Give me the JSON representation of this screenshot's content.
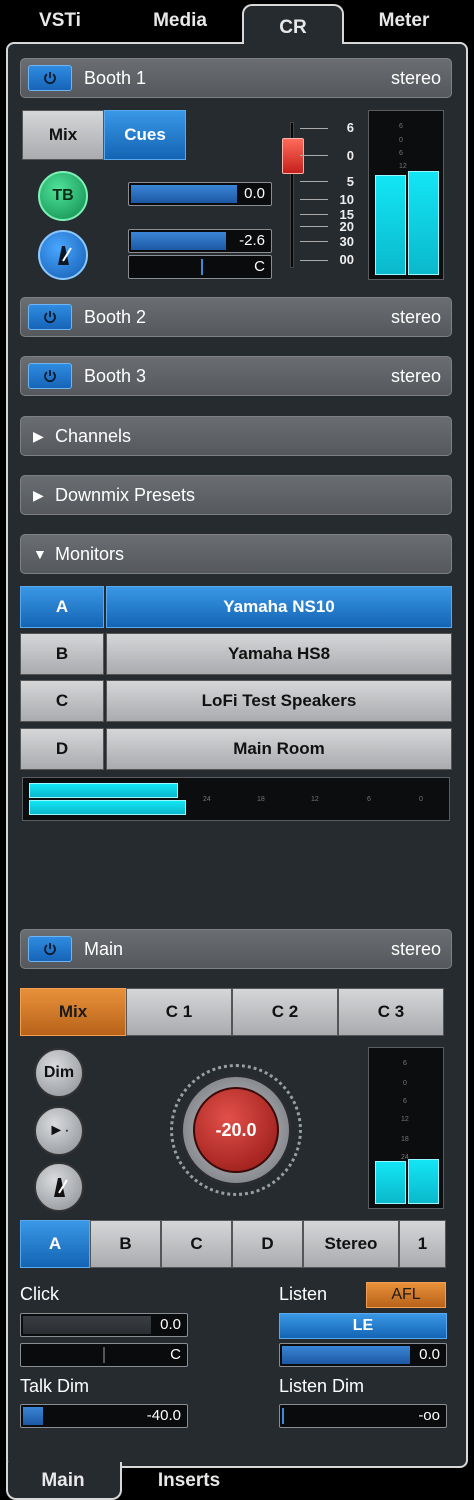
{
  "top_tabs": [
    "VSTi",
    "Media",
    "CR",
    "Meter"
  ],
  "booth1": {
    "name": "Booth 1",
    "format": "stereo",
    "mix_label": "Mix",
    "cues_label": "Cues",
    "tb_label": "TB",
    "level1": "0.0",
    "level2": "-2.6",
    "pan": "C",
    "fader_scale": [
      "6",
      "0",
      "5",
      "10",
      "15",
      "20",
      "30",
      "00"
    ],
    "meter_scale": [
      "6",
      "0",
      "6",
      "12"
    ],
    "meter_levels": [
      0.62,
      0.64
    ]
  },
  "booth2": {
    "name": "Booth 2",
    "format": "stereo"
  },
  "booth3": {
    "name": "Booth 3",
    "format": "stereo"
  },
  "channels": {
    "name": "Channels"
  },
  "downmix": {
    "name": "Downmix Presets"
  },
  "monitors": {
    "name": "Monitors",
    "items": [
      {
        "key": "A",
        "name": "Yamaha NS10"
      },
      {
        "key": "B",
        "name": "Yamaha HS8"
      },
      {
        "key": "C",
        "name": "LoFi Test Speakers"
      },
      {
        "key": "D",
        "name": "Main Room"
      }
    ],
    "meter_scale": [
      "24",
      "18",
      "12",
      "6",
      "0"
    ],
    "meter_levels": [
      0.36,
      0.38
    ]
  },
  "main": {
    "name": "Main",
    "format": "stereo",
    "source_tabs": [
      "Mix",
      "C 1",
      "C 2",
      "C 3"
    ],
    "dim_label": "Dim",
    "knob_value": "-20.0",
    "meter_scale": [
      "6",
      "0",
      "6",
      "12",
      "18",
      "24"
    ],
    "meter_levels": [
      0.28,
      0.29
    ],
    "speaker_buttons": [
      "A",
      "B",
      "C",
      "D",
      "Stereo",
      "1"
    ],
    "click_label": "Click",
    "click_level": "0.0",
    "click_pan": "C",
    "listen_label": "Listen",
    "afl_label": "AFL",
    "le_label": "LE",
    "listen_level": "0.0",
    "talk_dim_label": "Talk Dim",
    "talk_dim_value": "-40.0",
    "listen_dim_label": "Listen Dim",
    "listen_dim_value": "-oo"
  },
  "bottom_tabs": [
    "Main",
    "Inserts"
  ]
}
